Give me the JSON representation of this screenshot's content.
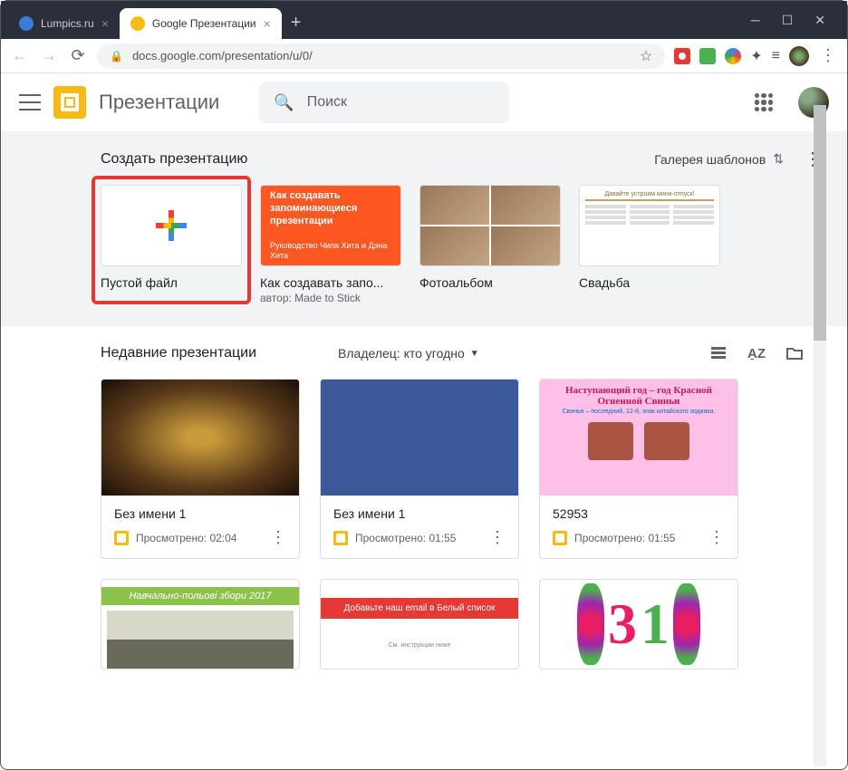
{
  "browser": {
    "tabs": [
      {
        "title": "Lumpics.ru",
        "favicon_color": "#3a7bd5"
      },
      {
        "title": "Google Презентации",
        "favicon_color": "#f5ba14"
      }
    ],
    "url": "docs.google.com/presentation/u/0/"
  },
  "app": {
    "title": "Презентации",
    "search_placeholder": "Поиск"
  },
  "templates": {
    "heading": "Создать презентацию",
    "gallery_label": "Галерея шаблонов",
    "items": [
      {
        "name": "Пустой файл",
        "subtitle": ""
      },
      {
        "name": "Как создавать запо...",
        "subtitle": "автор: Made to Stick",
        "thumb_title": "Как создавать запоминающиеся презентации"
      },
      {
        "name": "Фотоальбом",
        "subtitle": ""
      },
      {
        "name": "Свадьба",
        "subtitle": "",
        "thumb_title": "Давайте устроим мини-отпуск!"
      }
    ]
  },
  "recent": {
    "heading": "Недавние презентации",
    "owner_label": "Владелец: кто угодно",
    "cards": [
      {
        "title": "Без имени 1",
        "meta": "Просмотрено: 02:04"
      },
      {
        "title": "Без имени 1",
        "meta": "Просмотрено: 01:55"
      },
      {
        "title": "52953",
        "meta": "Просмотрено: 01:55",
        "thumb_line1": "Наступающий год – год Красной Огненной Свиньи",
        "thumb_line2": "Свинья – последний, 12-й, знак китайского зодиака."
      },
      {
        "title": "",
        "meta": "",
        "thumb_text": "Навчально-польові збори 2017"
      },
      {
        "title": "",
        "meta": "",
        "thumb_text": "Добавьте наш email в Белый список",
        "thumb_sub": "См. инструкции ниже"
      },
      {
        "title": "",
        "meta": ""
      }
    ]
  }
}
